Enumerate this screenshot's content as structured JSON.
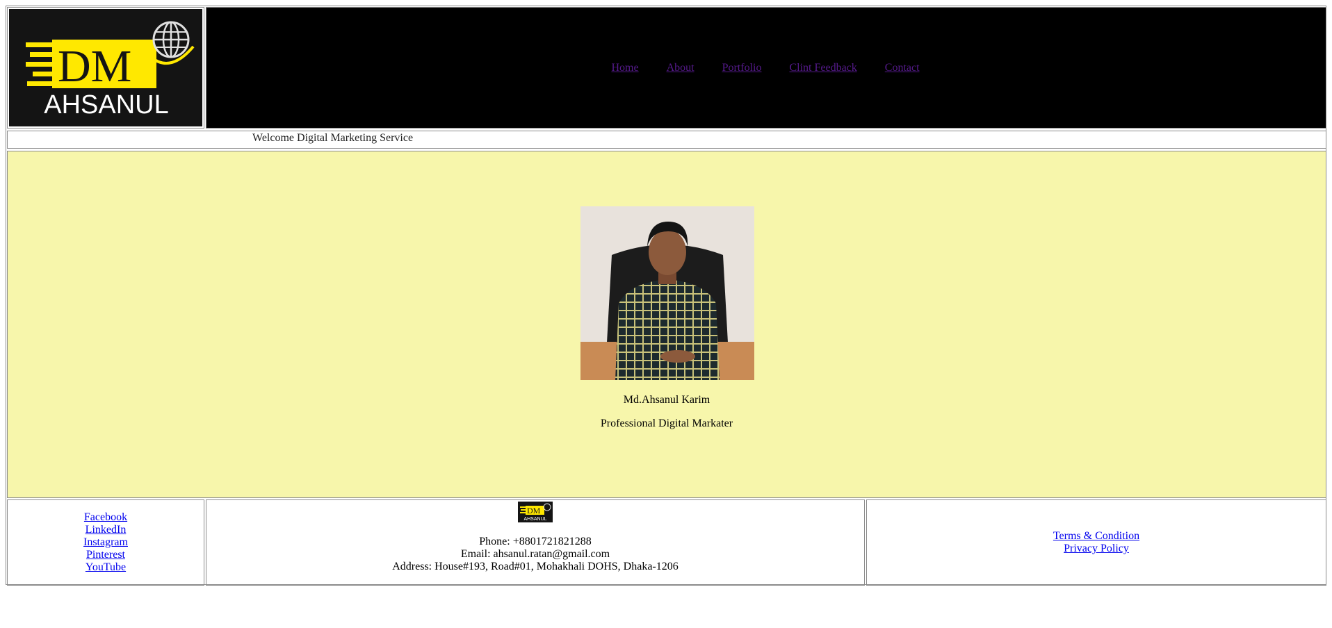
{
  "header": {
    "logo": {
      "mark": "DM",
      "name": "AHSANUL"
    },
    "nav": [
      {
        "label": "Home"
      },
      {
        "label": "About"
      },
      {
        "label": "Portfolio"
      },
      {
        "label": "Clint Feedback"
      },
      {
        "label": "Contact"
      }
    ]
  },
  "welcome": {
    "text": "Welcome Digital Marketing Service"
  },
  "hero": {
    "name": "Md.Ahsanul Karim",
    "role": "Professional Digital Markater"
  },
  "footer": {
    "social": [
      {
        "label": "Facebook"
      },
      {
        "label": "LinkedIn"
      },
      {
        "label": "Instagram"
      },
      {
        "label": "Pinterest"
      },
      {
        "label": "YouTube"
      }
    ],
    "contact": {
      "phone": "Phone: +8801721821288",
      "email": "Email: ahsanul.ratan@gmail.com",
      "address": "Address: House#193, Road#01, Mohakhali DOHS, Dhaka-1206"
    },
    "legal": [
      {
        "label": "Terms & Condition"
      },
      {
        "label": "Privacy Policy"
      }
    ]
  },
  "colors": {
    "logo_yellow": "#ffe800",
    "nav_link": "#551a8b",
    "hero_bg": "#f7f6ab",
    "header_bg": "#000000",
    "link": "#0000ee"
  }
}
